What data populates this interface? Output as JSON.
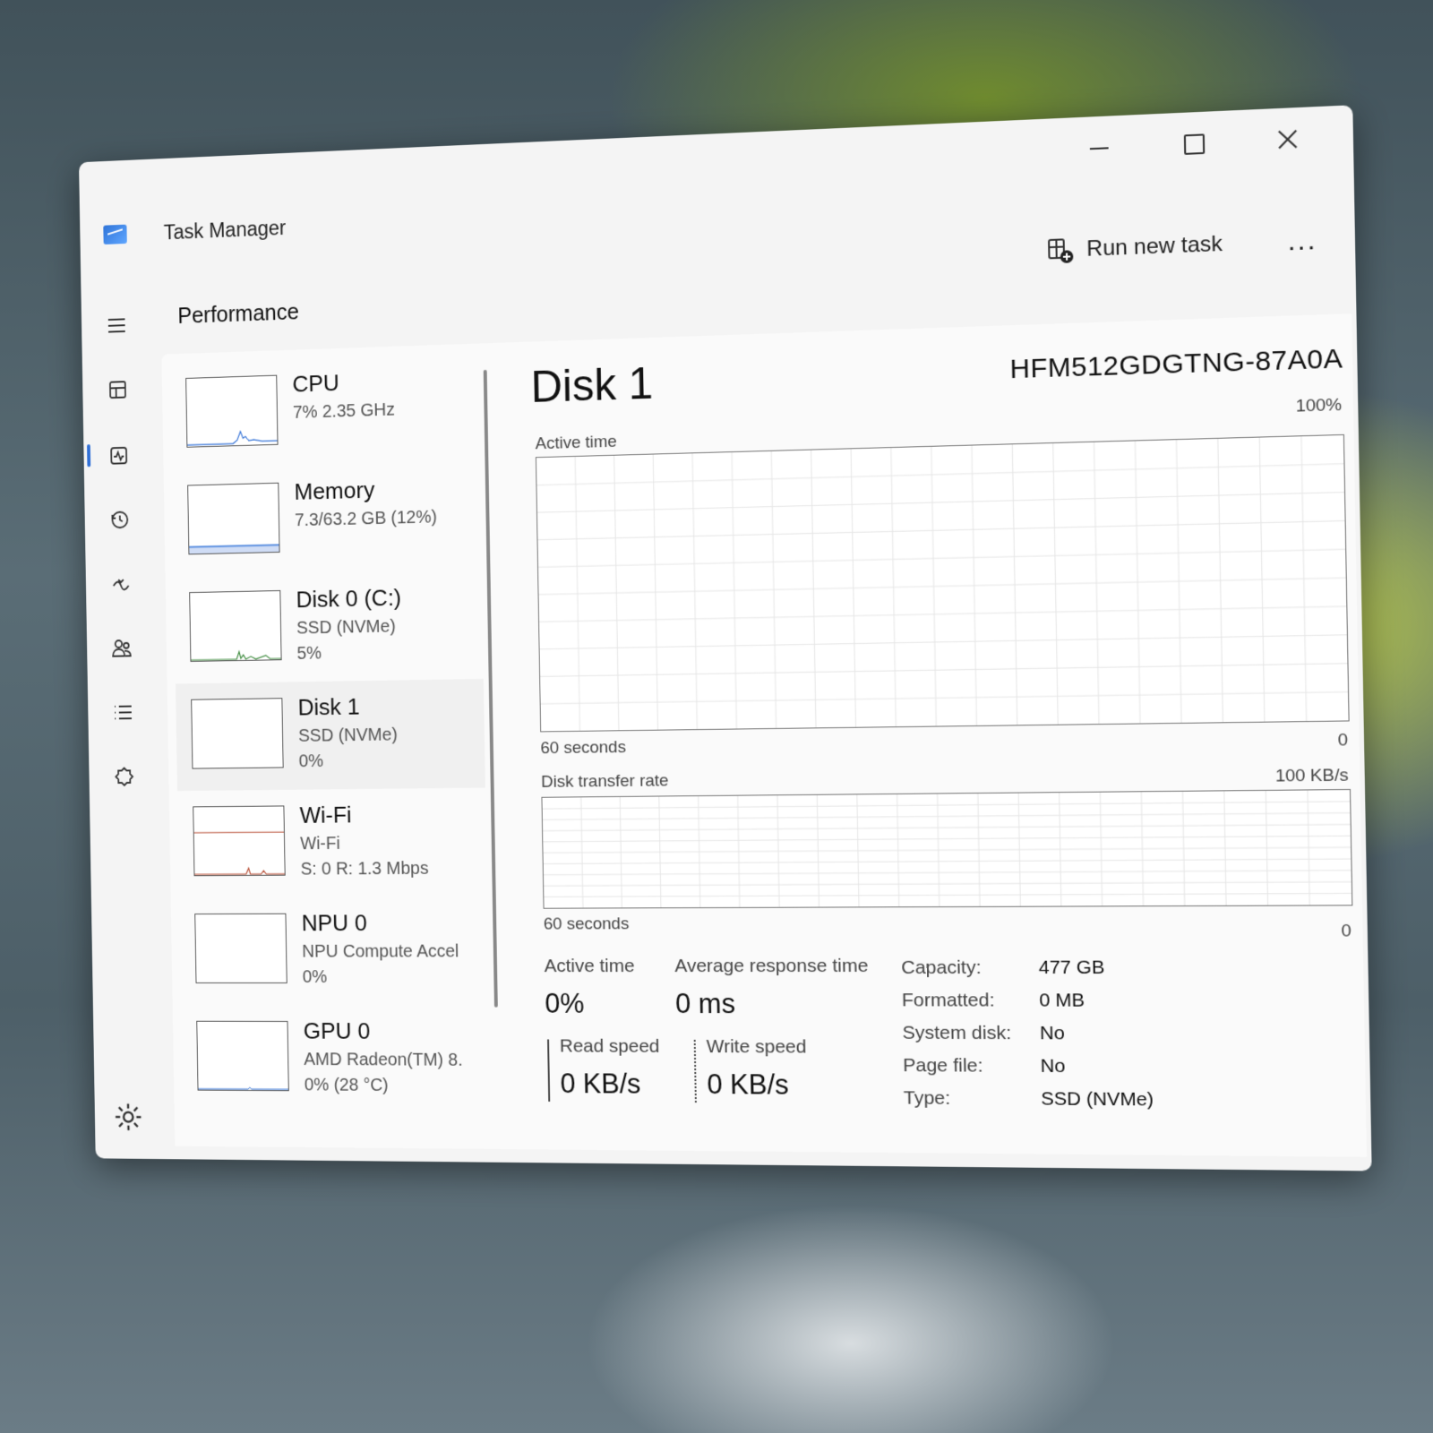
{
  "window": {
    "title": "Task Manager"
  },
  "header": {
    "page_title": "Performance",
    "run_new_task": "Run new task",
    "more": "..."
  },
  "nav": [
    "hamburger-icon",
    "processes-icon",
    "performance-icon",
    "app-history-icon",
    "startup-apps-icon",
    "users-icon",
    "details-icon",
    "services-icon",
    "settings-icon"
  ],
  "devices": [
    {
      "name": "CPU",
      "line1": "7% 2.35 GHz",
      "line2": ""
    },
    {
      "name": "Memory",
      "line1": "7.3/63.2 GB (12%)",
      "line2": ""
    },
    {
      "name": "Disk 0 (C:)",
      "line1": "SSD (NVMe)",
      "line2": "5%"
    },
    {
      "name": "Disk 1",
      "line1": "SSD (NVMe)",
      "line2": "0%"
    },
    {
      "name": "Wi-Fi",
      "line1": "Wi-Fi",
      "line2": "S: 0 R: 1.3 Mbps"
    },
    {
      "name": "NPU 0",
      "line1": "NPU Compute Accel",
      "line2": "0%"
    },
    {
      "name": "GPU 0",
      "line1": "AMD Radeon(TM) 8.",
      "line2": "0% (28 °C)"
    }
  ],
  "detail": {
    "title": "Disk 1",
    "model": "HFM512GDGTNG-87A0A",
    "active_chart": {
      "label": "Active time",
      "max": "100%",
      "xlabel": "60 seconds",
      "zero": "0"
    },
    "transfer_chart": {
      "label": "Disk transfer rate",
      "max": "100 KB/s",
      "xlabel": "60 seconds",
      "zero": "0"
    },
    "stats": {
      "active_time_label": "Active time",
      "active_time_value": "0%",
      "avg_response_label": "Average response time",
      "avg_response_value": "0 ms",
      "read_speed_label": "Read speed",
      "read_speed_value": "0 KB/s",
      "write_speed_label": "Write speed",
      "write_speed_value": "0 KB/s"
    },
    "properties": [
      {
        "key": "Capacity:",
        "value": "477 GB"
      },
      {
        "key": "Formatted:",
        "value": "0 MB"
      },
      {
        "key": "System disk:",
        "value": "No"
      },
      {
        "key": "Page file:",
        "value": "No"
      },
      {
        "key": "Type:",
        "value": "SSD (NVMe)"
      }
    ]
  },
  "colors": {
    "accent": "#2f6fd6",
    "cpu_line": "#2f6fd6",
    "memory_fill": "#5b8fe0",
    "disk_line": "#3c8a3c",
    "wifi_line": "#b5472d"
  }
}
